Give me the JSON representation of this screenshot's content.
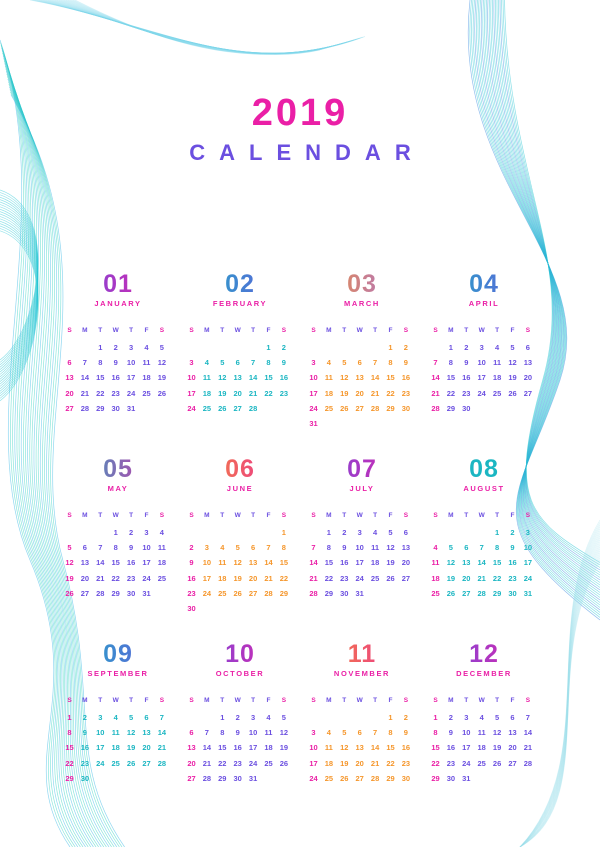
{
  "header": {
    "year": "2019",
    "title": "CALENDAR"
  },
  "weekday_labels": [
    "S",
    "M",
    "T",
    "W",
    "T",
    "F",
    "S"
  ],
  "colors": {
    "pink": "#ea1fa6",
    "purple": "#6b4fe0",
    "teal": "#1bb6c2",
    "orange": "#f5962b",
    "cyan_line": "#27c7d6"
  },
  "months": [
    {
      "num": "01",
      "name": "JANUARY",
      "start": 2,
      "days": 31,
      "numColor": [
        "#6b4fe0",
        "#ea1fa6"
      ],
      "nameColor": "#ea1fa6",
      "dayColor": "#6b4fe0"
    },
    {
      "num": "02",
      "name": "FEBRUARY",
      "start": 5,
      "days": 28,
      "numColor": [
        "#1bb6c2",
        "#6b4fe0"
      ],
      "nameColor": "#ea1fa6",
      "dayColor": "#1bb6c2"
    },
    {
      "num": "03",
      "name": "MARCH",
      "start": 5,
      "days": 31,
      "numColor": [
        "#f5962b",
        "#a16ae8"
      ],
      "nameColor": "#ea1fa6",
      "dayColor": "#f5962b"
    },
    {
      "num": "04",
      "name": "APRIL",
      "start": 1,
      "days": 30,
      "numColor": [
        "#1bb6c2",
        "#6b4fe0"
      ],
      "nameColor": "#ea1fa6",
      "dayColor": "#6b4fe0"
    },
    {
      "num": "05",
      "name": "MAY",
      "start": 3,
      "days": 31,
      "numColor": [
        "#1bb6c2",
        "#ea1fa6"
      ],
      "nameColor": "#ea1fa6",
      "dayColor": "#6b4fe0"
    },
    {
      "num": "06",
      "name": "JUNE",
      "start": 6,
      "days": 30,
      "numColor": [
        "#f5962b",
        "#ea1fa6"
      ],
      "nameColor": "#ea1fa6",
      "dayColor": "#f5962b"
    },
    {
      "num": "07",
      "name": "JULY",
      "start": 1,
      "days": 31,
      "numColor": [
        "#6b4fe0",
        "#ea1fa6"
      ],
      "nameColor": "#ea1fa6",
      "dayColor": "#6b4fe0"
    },
    {
      "num": "08",
      "name": "AUGUST",
      "start": 4,
      "days": 31,
      "numColor": [
        "#1bb6c2",
        "#1bb6c2"
      ],
      "nameColor": "#ea1fa6",
      "dayColor": "#1bb6c2"
    },
    {
      "num": "09",
      "name": "SEPTEMBER",
      "start": 0,
      "days": 30,
      "numColor": [
        "#1bb6c2",
        "#6b4fe0"
      ],
      "nameColor": "#ea1fa6",
      "dayColor": "#1bb6c2"
    },
    {
      "num": "10",
      "name": "OCTOBER",
      "start": 2,
      "days": 31,
      "numColor": [
        "#6b4fe0",
        "#ea1fa6"
      ],
      "nameColor": "#ea1fa6",
      "dayColor": "#6b4fe0"
    },
    {
      "num": "11",
      "name": "NOVEMBER",
      "start": 5,
      "days": 30,
      "numColor": [
        "#f5962b",
        "#ea1fa6"
      ],
      "nameColor": "#ea1fa6",
      "dayColor": "#f5962b"
    },
    {
      "num": "12",
      "name": "DECEMBER",
      "start": 0,
      "days": 31,
      "numColor": [
        "#6b4fe0",
        "#ea1fa6"
      ],
      "nameColor": "#ea1fa6",
      "dayColor": "#6b4fe0"
    }
  ]
}
